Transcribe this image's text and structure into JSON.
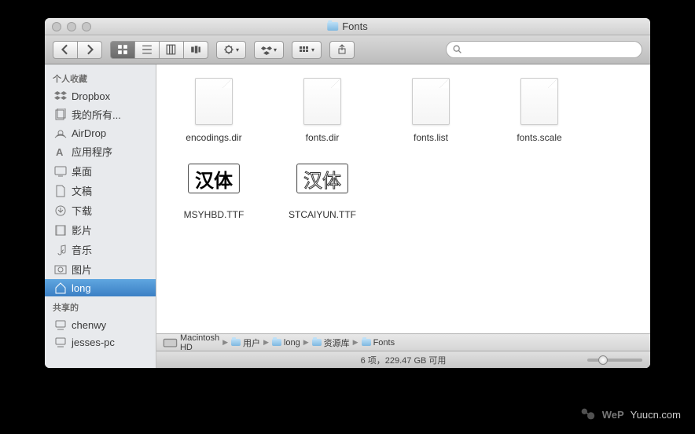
{
  "window": {
    "title": "Fonts"
  },
  "toolbar": {
    "nav": {
      "back": "◀",
      "forward": "▶"
    },
    "views": [
      "icon",
      "list",
      "column",
      "coverflow"
    ],
    "search_placeholder": ""
  },
  "sidebar": {
    "sections": [
      {
        "header": "个人收藏",
        "items": [
          {
            "icon": "dropbox",
            "label": "Dropbox"
          },
          {
            "icon": "allfiles",
            "label": "我的所有..."
          },
          {
            "icon": "airdrop",
            "label": "AirDrop"
          },
          {
            "icon": "apps",
            "label": "应用程序"
          },
          {
            "icon": "desktop",
            "label": "桌面"
          },
          {
            "icon": "documents",
            "label": "文稿"
          },
          {
            "icon": "downloads",
            "label": "下载"
          },
          {
            "icon": "movies",
            "label": "影片"
          },
          {
            "icon": "music",
            "label": "音乐"
          },
          {
            "icon": "pictures",
            "label": "图片"
          },
          {
            "icon": "home",
            "label": "long",
            "selected": true
          }
        ]
      },
      {
        "header": "共享的",
        "items": [
          {
            "icon": "computer",
            "label": "chenwy"
          },
          {
            "icon": "computer",
            "label": "jesses-pc"
          }
        ]
      }
    ]
  },
  "files": [
    {
      "type": "doc",
      "name": "encodings.dir"
    },
    {
      "type": "doc",
      "name": "fonts.dir"
    },
    {
      "type": "doc",
      "name": "fonts.list"
    },
    {
      "type": "doc",
      "name": "fonts.scale"
    },
    {
      "type": "font",
      "style": "bold",
      "preview": "汉体",
      "name": "MSYHBD.TTF"
    },
    {
      "type": "font",
      "style": "outline",
      "preview": "汉体",
      "name": "STCAIYUN.TTF"
    }
  ],
  "path": [
    {
      "icon": "disk",
      "label": "Macintosh HD"
    },
    {
      "icon": "folder",
      "label": "用户"
    },
    {
      "icon": "folder",
      "label": "long"
    },
    {
      "icon": "folder",
      "label": "资源库"
    },
    {
      "icon": "folder",
      "label": "Fonts"
    }
  ],
  "status": "6 项，229.47 GB 可用",
  "watermark": {
    "brand": "WeP",
    "site": "Yuucn.com"
  }
}
